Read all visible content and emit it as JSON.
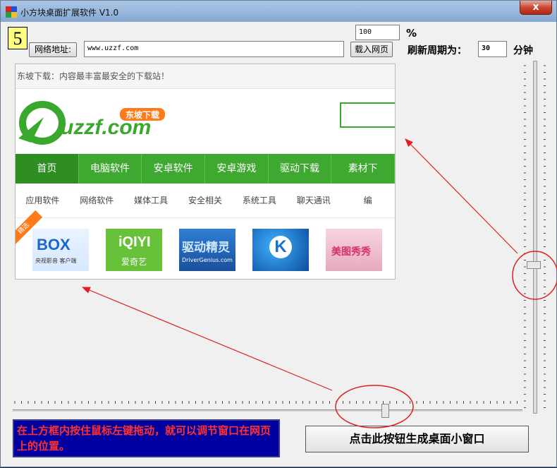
{
  "window": {
    "title": "小方块桌面扩展软件 V1.0",
    "close_glyph": "x"
  },
  "controls": {
    "number_badge": "5",
    "opacity_value": "100",
    "percent_sign": "%",
    "url_button": "网络地址:",
    "url_value": "www.uzzf.com",
    "load_button": "载入网页",
    "refresh_label": "刷新周期为：",
    "refresh_value": "30",
    "minutes_label": "分钟"
  },
  "webpage": {
    "tagline": "东坡下载：内容最丰富最安全的下载站！",
    "logo_text": "uzzf.com",
    "logo_badge": "东坡下载",
    "nav": [
      "首页",
      "电脑软件",
      "安卓软件",
      "安卓游戏",
      "驱动下载",
      "素材下"
    ],
    "subnav": [
      "应用软件",
      "网络软件",
      "媒体工具",
      "安全相关",
      "系统工具",
      "聊天通讯",
      "编"
    ],
    "featured_ribbon": "精选",
    "apps": [
      {
        "icon": "box-app-icon",
        "label": "BOX",
        "sub": "央视影音 客户端"
      },
      {
        "icon": "iqiyi-app-icon",
        "label": "iQIYI",
        "sub": "爱奇艺"
      },
      {
        "icon": "drivergenius-app-icon",
        "label": "驱动精灵",
        "sub": "DriverGenius.com"
      },
      {
        "icon": "kugou-app-icon",
        "label": "K",
        "sub": ""
      },
      {
        "icon": "meitu-app-icon",
        "label": "美图秀秀",
        "sub": ""
      }
    ]
  },
  "footer": {
    "instruction": "在上方框内按住鼠标左键拖动，就可以调节窗口在网页上的位置。",
    "generate_button": "点击此按钮生成桌面小窗口"
  },
  "sliders": {
    "horizontal_level": 0.73,
    "vertical_level": 0.6
  },
  "colors": {
    "brand_green": "#3fa830",
    "info_bg": "#0000a0",
    "info_text": "#ff3030",
    "badge_bg": "#ffff80",
    "annotation_red": "#e02020"
  }
}
